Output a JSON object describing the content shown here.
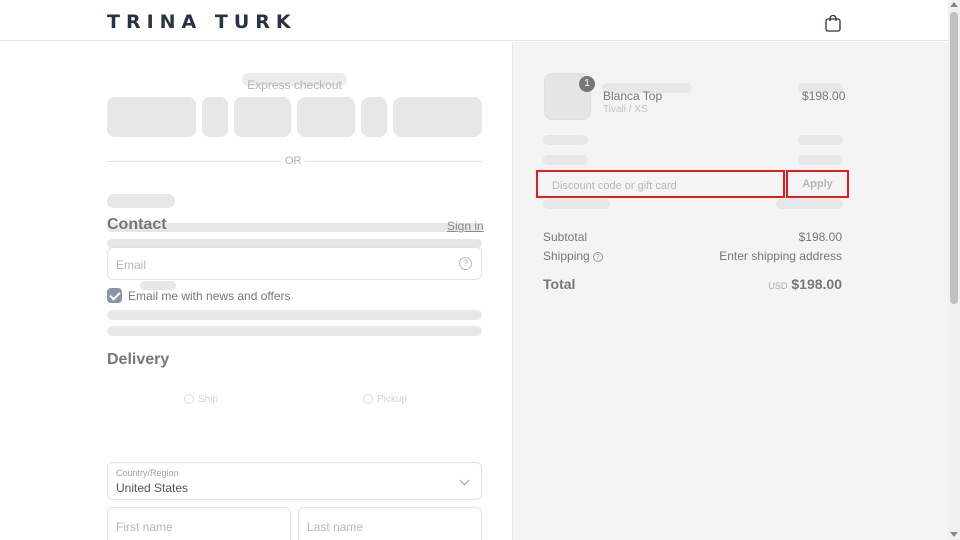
{
  "header": {
    "logo_text": "TRINA TURK",
    "cart_icon": "shopping-bag-icon"
  },
  "left": {
    "express_checkout_label": "Express checkout",
    "or_text": "OR",
    "contact_title": "Contact",
    "sign_in_link": "Sign in",
    "email_placeholder": "Email",
    "news_checkbox_label": "Email me with news and offers",
    "news_checkbox_checked": true,
    "delivery_title": "Delivery",
    "ship_option": "Ship",
    "pickup_option": "Pickup",
    "country_label": "Country/Region",
    "country_value": "United States",
    "first_name_placeholder": "First name",
    "last_name_placeholder": "Last name"
  },
  "summary": {
    "item": {
      "quantity": "1",
      "name": "Blanca Top",
      "variant": "Tivali / XS",
      "price": "$198.00"
    },
    "discount_placeholder": "Discount code or gift card",
    "apply_label": "Apply",
    "subtotal_label": "Subtotal",
    "subtotal_value": "$198.00",
    "shipping_label": "Shipping",
    "shipping_value": "Enter shipping address",
    "total_label": "Total",
    "total_currency": "USD",
    "total_value": "$198.00"
  },
  "colors": {
    "highlight": "#e31b23",
    "summary_bg": "#f4f4f4",
    "checkbox": "#8a96a8"
  }
}
